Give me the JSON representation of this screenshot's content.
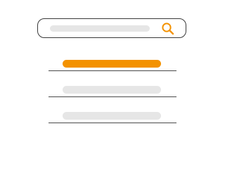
{
  "colors": {
    "accent": "#f39200",
    "placeholder": "#e6e6e6",
    "border": "#3a3a3a",
    "divider": "#4a4a4a"
  },
  "search": {
    "icon": "search-icon"
  },
  "results": {
    "items": [
      {
        "state": "highlighted"
      },
      {
        "state": "default"
      },
      {
        "state": "default"
      }
    ]
  }
}
